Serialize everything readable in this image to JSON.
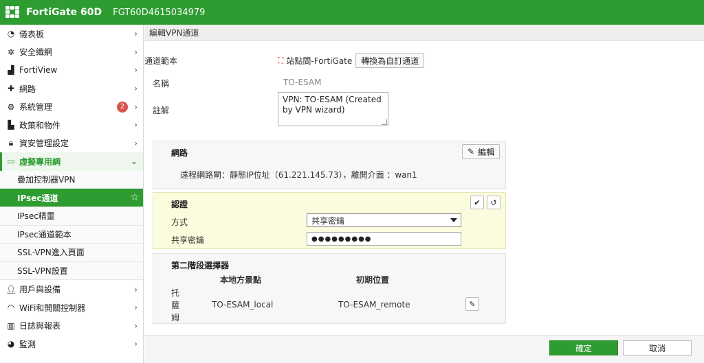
{
  "header": {
    "brand": "FortiGate 60D",
    "serial": "FGT60D4615034979"
  },
  "sidebar": {
    "items": [
      {
        "label": "儀表板",
        "icon": "dashboard-icon"
      },
      {
        "label": "安全織網",
        "icon": "security-fabric-icon"
      },
      {
        "label": "FortiView",
        "icon": "chart-icon"
      },
      {
        "label": "網路",
        "icon": "network-icon"
      },
      {
        "label": "系統管理",
        "icon": "gear-icon",
        "badge": "2"
      },
      {
        "label": "政策和物件",
        "icon": "policy-icon"
      },
      {
        "label": "資安管理設定",
        "icon": "lock-icon"
      },
      {
        "label": "虛擬專用網",
        "icon": "laptop-icon"
      }
    ],
    "vpn_sub": [
      {
        "label": "疊加控制器VPN"
      },
      {
        "label": "IPsec通道"
      },
      {
        "label": "IPsec精靈"
      },
      {
        "label": "IPsec通道範本"
      },
      {
        "label": "SSL-VPN進入頁面"
      },
      {
        "label": "SSL-VPN設置"
      }
    ],
    "bottom_items": [
      {
        "label": "用戶與設備",
        "icon": "user-icon"
      },
      {
        "label": "WiFi和開關控制器",
        "icon": "wifi-icon"
      },
      {
        "label": "日誌與報表",
        "icon": "log-icon"
      },
      {
        "label": "監測",
        "icon": "monitor-icon"
      }
    ]
  },
  "page": {
    "title": "編輯VPN通道"
  },
  "form": {
    "template_label": "通道範本",
    "template_value": "站點間-FortiGate",
    "convert_button": "轉換為自訂通道",
    "name_label": "名稱",
    "name_value": "TO-ESAM",
    "comment_label": "註解",
    "comment_value": "VPN: TO-ESAM (Created by VPN wizard)"
  },
  "network": {
    "title": "網路",
    "edit_button": "編輯",
    "summary": "遠程網路閘：靜態IP位址（61.221.145.73），離開介面 ：wan1"
  },
  "auth": {
    "title": "認證",
    "method_label": "方式",
    "method_value": "共享密鑰",
    "psk_label": "共享密鑰",
    "psk_value": "●●●●●●●●●"
  },
  "phase2": {
    "title": "第二階段選擇器",
    "col_local": "本地方景點",
    "col_remote": "初期位置",
    "row_name": "托薩姆",
    "local_value": "TO-ESAM_local",
    "remote_value": "TO-ESAM_remote"
  },
  "footer": {
    "ok_label": "確定",
    "cancel_label": "取消"
  },
  "colors": {
    "brand_green": "#2e9c31",
    "badge_red": "#d9534f"
  }
}
